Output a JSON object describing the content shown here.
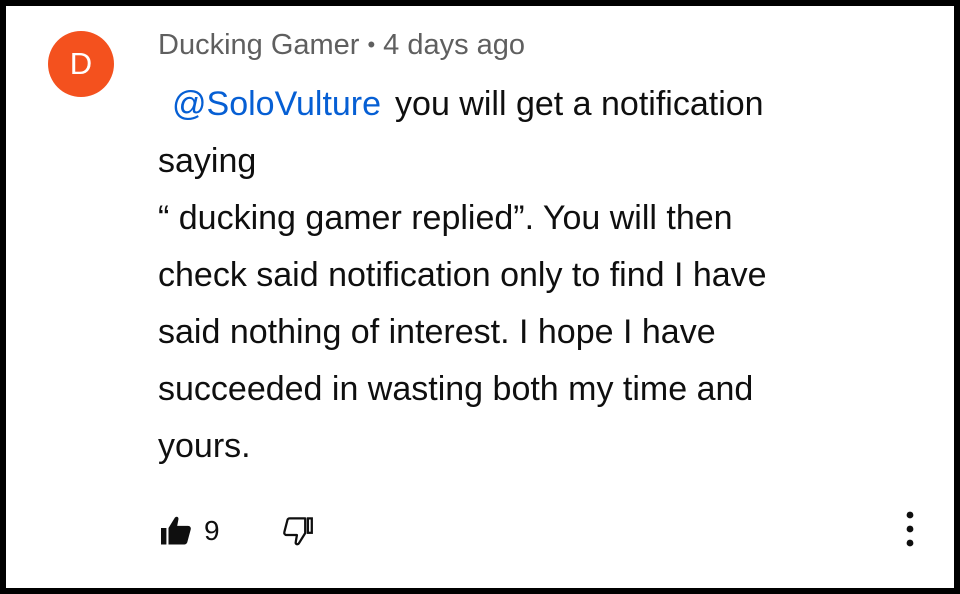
{
  "comment": {
    "avatar": {
      "letter": "D",
      "color": "#f4511e"
    },
    "author": "Ducking Gamer",
    "separator": "•",
    "timestamp": "4 days ago",
    "mention": "@SoloVulture",
    "lines": {
      "l1_text": "you will get a notification",
      "l2": "saying",
      "l3": "“ ducking gamer replied”. You will then",
      "l4": "check said notification only to find I have",
      "l5": "said nothing of interest. I hope I have",
      "l6": "succeeded in wasting both my time and",
      "l7": "yours."
    },
    "like_count": "9",
    "icons": {
      "like": "thumbs-up-filled-icon",
      "dislike": "thumbs-down-outline-icon",
      "more": "more-vertical-icon"
    },
    "colors": {
      "mention": "#065fd4",
      "meta": "#5f5f5f",
      "text": "#0f0f0f"
    }
  }
}
